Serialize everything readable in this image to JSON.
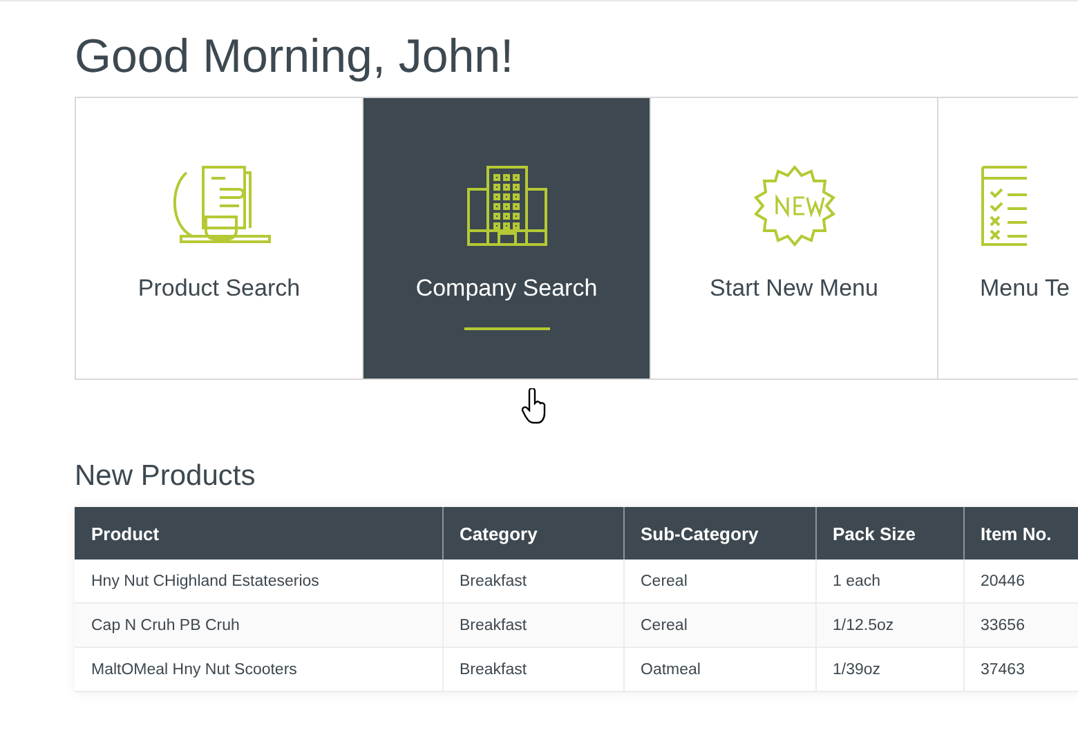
{
  "greeting": "Good Morning, John!",
  "tiles": [
    {
      "kind": "product",
      "label": "Product Search",
      "selected": false
    },
    {
      "kind": "company",
      "label": "Company Search",
      "selected": true
    },
    {
      "kind": "new",
      "label": "Start New Menu",
      "selected": false
    },
    {
      "kind": "menu",
      "label": "Menu Te",
      "selected": false
    }
  ],
  "new_products": {
    "title": "New Products",
    "columns": [
      "Product",
      "Category",
      "Sub-Category",
      "Pack Size",
      "Item No."
    ],
    "rows": [
      [
        "Hny Nut CHighland Estateserios",
        "Breakfast",
        "Cereal",
        "1 each",
        "20446"
      ],
      [
        "Cap N Cruh PB Cruh",
        "Breakfast",
        "Cereal",
        "1/12.5oz",
        "33656"
      ],
      [
        "MaltOMeal Hny Nut Scooters",
        "Breakfast",
        "Oatmeal",
        "1/39oz",
        "37463"
      ]
    ]
  }
}
